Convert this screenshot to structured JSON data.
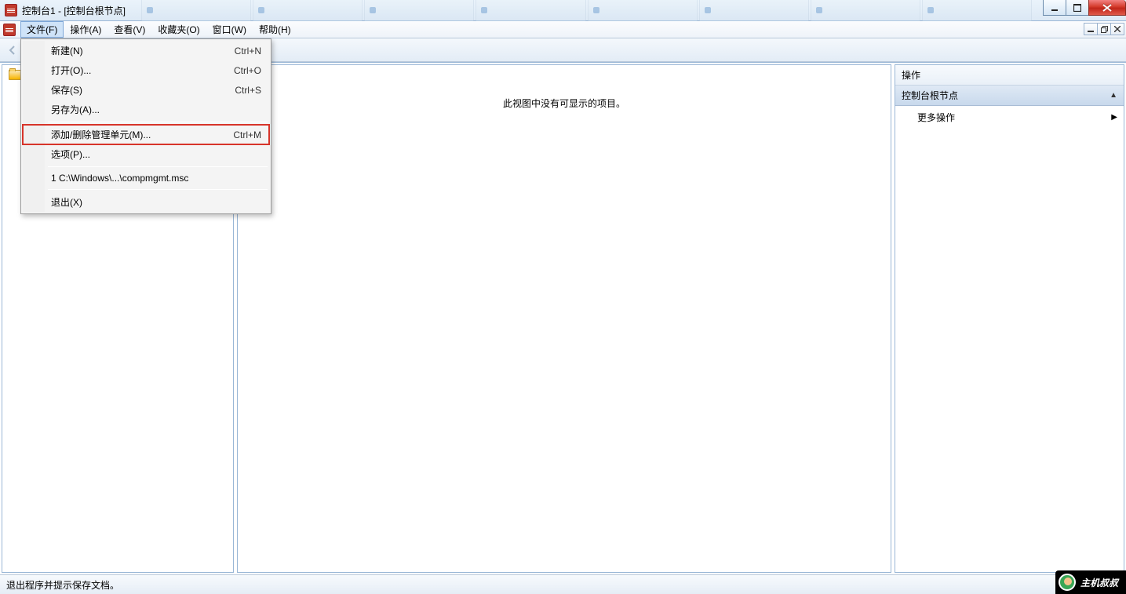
{
  "window": {
    "title": "控制台1 - [控制台根节点]"
  },
  "menubar": {
    "items": [
      "文件(F)",
      "操作(A)",
      "查看(V)",
      "收藏夹(O)",
      "窗口(W)",
      "帮助(H)"
    ]
  },
  "dropdown": {
    "new": {
      "label": "新建(N)",
      "shortcut": "Ctrl+N"
    },
    "open": {
      "label": "打开(O)...",
      "shortcut": "Ctrl+O"
    },
    "save": {
      "label": "保存(S)",
      "shortcut": "Ctrl+S"
    },
    "saveas": {
      "label": "另存为(A)..."
    },
    "addremove": {
      "label": "添加/删除管理单元(M)...",
      "shortcut": "Ctrl+M"
    },
    "options": {
      "label": "选项(P)..."
    },
    "recent1": {
      "label": "1 C:\\Windows\\...\\compmgmt.msc"
    },
    "exit": {
      "label": "退出(X)"
    }
  },
  "tree": {
    "root_visible_hint": ""
  },
  "content": {
    "empty_message": "此视图中没有可显示的项目。"
  },
  "actions": {
    "header": "操作",
    "section": "控制台根节点",
    "more": "更多操作"
  },
  "statusbar": {
    "text": "退出程序并提示保存文档。"
  },
  "watermark": {
    "text": "主机叔叔"
  }
}
